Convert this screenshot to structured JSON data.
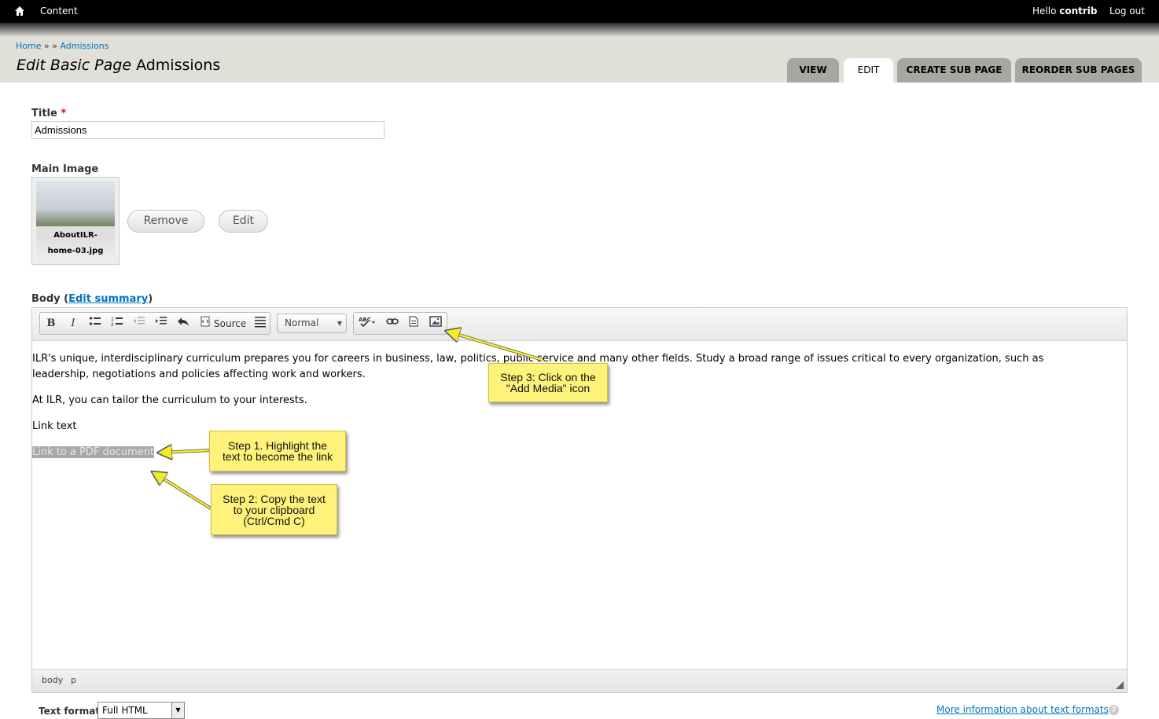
{
  "topbar": {
    "home_icon": "home-icon",
    "content": "Content",
    "hello_prefix": "Hello",
    "username": "contrib",
    "logout": "Log out"
  },
  "breadcrumb": {
    "home": "Home",
    "separator": "» »",
    "current": "Admissions"
  },
  "page_title": {
    "prefix": "Edit Basic Page",
    "name": "Admissions"
  },
  "tabs": [
    {
      "label": "VIEW"
    },
    {
      "label": "EDIT"
    },
    {
      "label": "CREATE SUB PAGE"
    },
    {
      "label": "REORDER SUB PAGES"
    }
  ],
  "form": {
    "title_label": "Title",
    "required_mark": "*",
    "title_value": "Admissions",
    "main_image_label": "Main Image",
    "image_caption_1": "AboutILR-",
    "image_caption_2": "home-03.jpg",
    "remove_button": "Remove",
    "edit_button": "Edit",
    "body_label": "Body",
    "edit_summary": "Edit summary"
  },
  "editor": {
    "toolbar": {
      "bold": "B",
      "italic": "I",
      "source": "Source",
      "format_value": "Normal"
    },
    "paragraphs": [
      "ILR's unique, interdisciplinary curriculum prepares you for careers in business, law, politics, public service and many other fields. Study a broad range of issues critical to every organization, such as leadership, negotiations and policies affecting work and workers.",
      "At ILR, you can tailor the curriculum to your interests.",
      "Link text",
      "Link to a PDF document"
    ],
    "path": [
      "body",
      "p"
    ]
  },
  "text_format": {
    "label": "Text format",
    "value": "Full HTML",
    "more_info": "More information about text formats",
    "help_icon": "?"
  },
  "callouts": {
    "step1": [
      "Step 1. Highlight the",
      "text to become the link"
    ],
    "step2": [
      "Step 2: Copy the text",
      "to your clipboard",
      "(Ctrl/Cmd C)"
    ],
    "step3": [
      "Step 3: Click on the",
      "\"Add Media\" icon"
    ]
  },
  "colors": {
    "link": "#0074bd",
    "callout": "#fff27a",
    "highlight": "#a8a8a8"
  }
}
